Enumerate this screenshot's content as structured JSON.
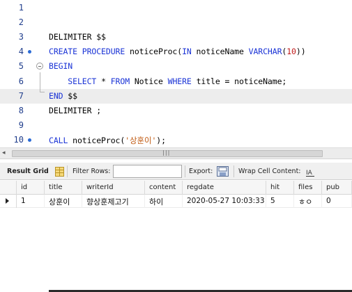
{
  "editor": {
    "lines": [
      {
        "num": "1",
        "breakpoint": false,
        "current": false,
        "tokens": []
      },
      {
        "num": "2",
        "breakpoint": false,
        "current": false,
        "tokens": []
      },
      {
        "num": "3",
        "breakpoint": false,
        "current": false,
        "tokens": [
          {
            "t": "DELIMITER $$",
            "c": ""
          }
        ]
      },
      {
        "num": "4",
        "breakpoint": true,
        "current": false,
        "tokens": [
          {
            "t": "CREATE PROCEDURE",
            "c": "kw"
          },
          {
            "t": " noticeProc(",
            "c": ""
          },
          {
            "t": "IN",
            "c": "kw"
          },
          {
            "t": " noticeName ",
            "c": ""
          },
          {
            "t": "VARCHAR",
            "c": "kw"
          },
          {
            "t": "(",
            "c": ""
          },
          {
            "t": "10",
            "c": "num"
          },
          {
            "t": "))",
            "c": ""
          }
        ]
      },
      {
        "num": "5",
        "breakpoint": false,
        "current": false,
        "fold": true,
        "tokens": [
          {
            "t": "BEGIN",
            "c": "kw"
          }
        ]
      },
      {
        "num": "6",
        "breakpoint": false,
        "current": false,
        "tokens": [
          {
            "t": "    SELECT",
            "c": "kw"
          },
          {
            "t": " * ",
            "c": ""
          },
          {
            "t": "FROM",
            "c": "kw"
          },
          {
            "t": " Notice ",
            "c": ""
          },
          {
            "t": "WHERE",
            "c": "kw"
          },
          {
            "t": " title = noticeName;",
            "c": ""
          }
        ]
      },
      {
        "num": "7",
        "breakpoint": false,
        "current": true,
        "tokens": [
          {
            "t": "END",
            "c": "kw"
          },
          {
            "t": " $$",
            "c": ""
          }
        ]
      },
      {
        "num": "8",
        "breakpoint": false,
        "current": false,
        "tokens": [
          {
            "t": "DELIMITER ;",
            "c": ""
          }
        ]
      },
      {
        "num": "9",
        "breakpoint": false,
        "current": false,
        "tokens": []
      },
      {
        "num": "10",
        "breakpoint": true,
        "current": false,
        "tokens": [
          {
            "t": "CALL",
            "c": "kw"
          },
          {
            "t": " noticeProc(",
            "c": ""
          },
          {
            "t": "'상훈이'",
            "c": "str"
          },
          {
            "t": ");",
            "c": ""
          }
        ]
      }
    ]
  },
  "toolbar": {
    "result_grid_label": "Result Grid",
    "filter_rows_label": "Filter Rows:",
    "filter_value": "",
    "export_label": "Export:",
    "wrap_label": "Wrap Cell Content:"
  },
  "icons": {
    "grid": "grid-icon",
    "export": "export-icon",
    "wrap": "wrap-cell-icon"
  },
  "colors": {
    "keyword": "#1a33d6",
    "number": "#c01a1a",
    "string": "#c05a12",
    "line_number": "#1f3d8c",
    "breakpoint": "#2b6bd6"
  },
  "grid": {
    "columns": [
      "id",
      "title",
      "writerId",
      "content",
      "regdate",
      "hit",
      "files",
      "pub"
    ],
    "rows": [
      [
        "1",
        "상훈이",
        "향상훈제고기",
        "하이",
        "2020-05-27 10:03:33",
        "5",
        "ㅎㅇ",
        "0"
      ]
    ]
  }
}
